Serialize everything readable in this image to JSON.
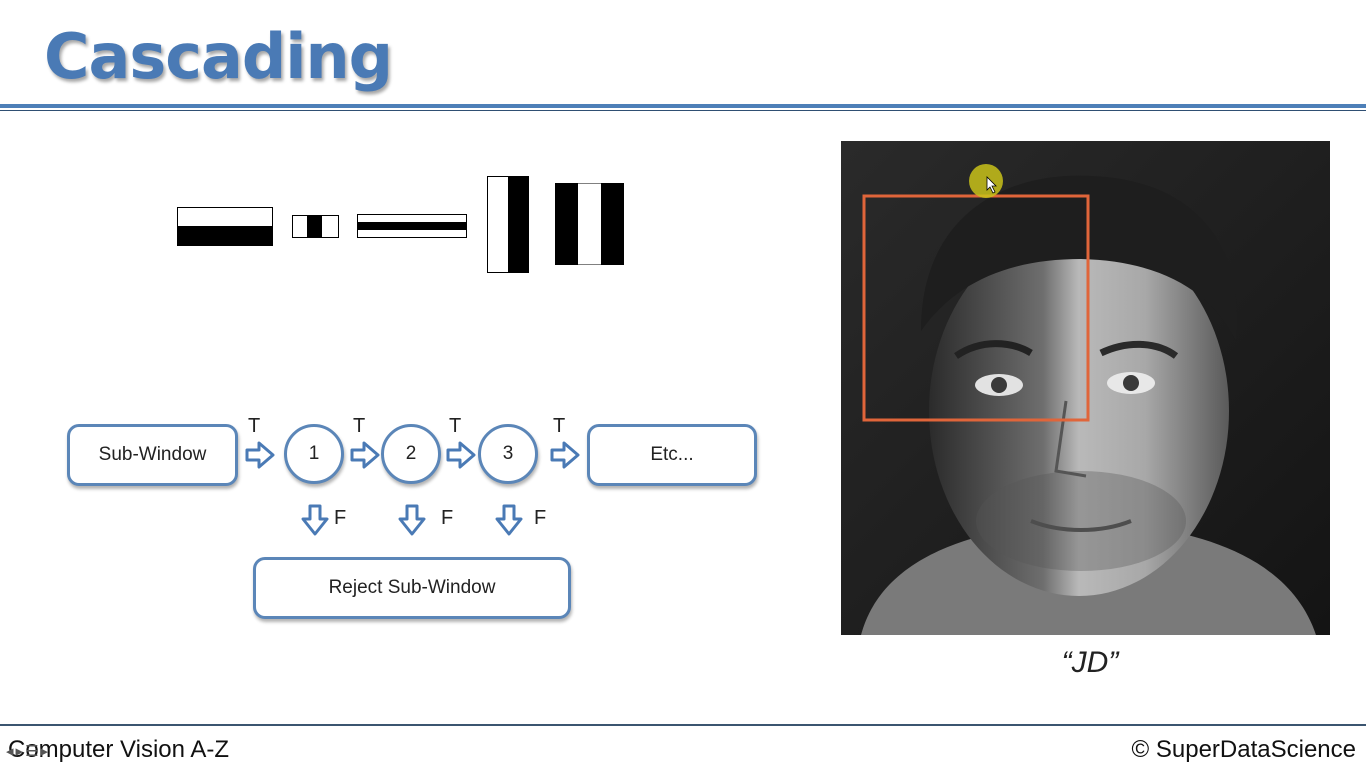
{
  "slide": {
    "title": "Cascading"
  },
  "flow": {
    "start": "Sub-Window",
    "stages": [
      "1",
      "2",
      "3"
    ],
    "end": "Etc...",
    "true_label": "T",
    "false_label": "F",
    "reject": "Reject Sub-Window"
  },
  "photo": {
    "caption": "“JD”"
  },
  "footer": {
    "left": "Computer Vision A-Z",
    "right": "© SuperDataScience"
  },
  "colors": {
    "accent": "#4a7ab5",
    "box_border": "#5b86b8",
    "detection_box": "#e0653a",
    "cursor_highlight": "#c9c21a"
  },
  "icons": [
    "right-arrow-icon",
    "down-arrow-icon",
    "cursor-icon",
    "play-icon"
  ]
}
